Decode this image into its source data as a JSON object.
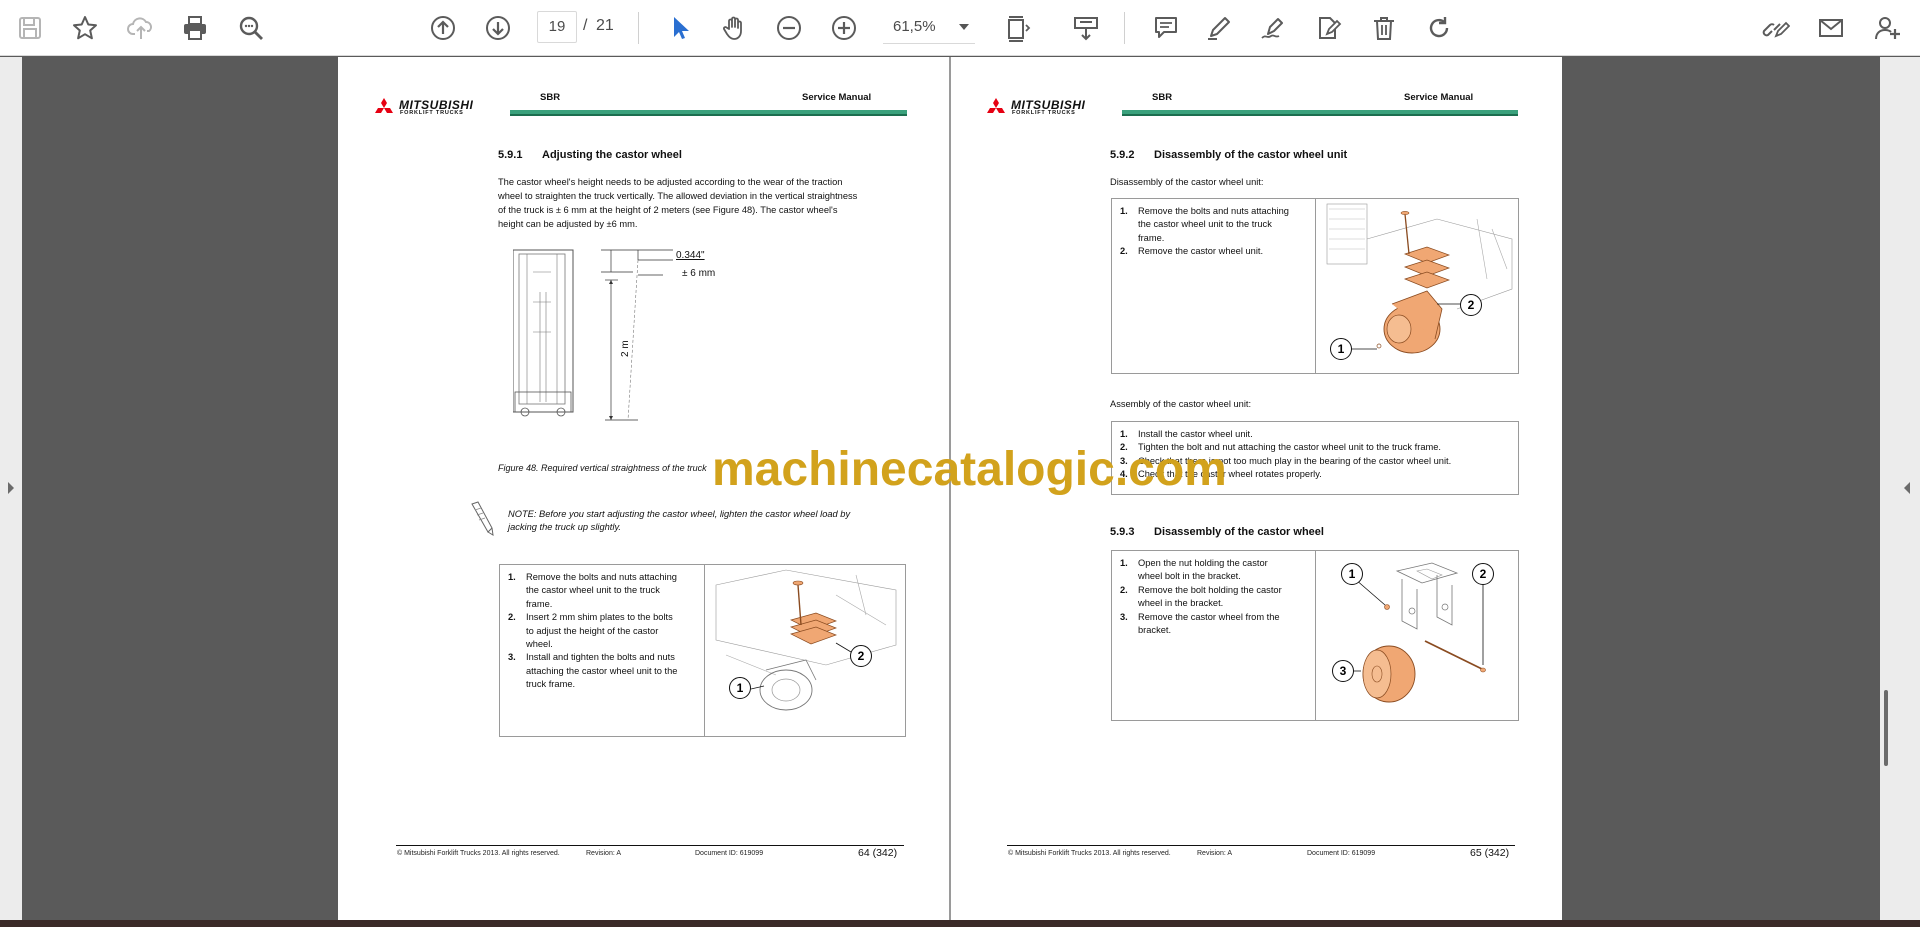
{
  "toolbar": {
    "page_current": "19",
    "page_separator": "/",
    "page_total": "21",
    "zoom_value": "61,5%"
  },
  "doc_header": {
    "brand_line1": "MITSUBISHI",
    "brand_line2": "FORKLIFT TRUCKS",
    "model": "SBR",
    "title": "Service Manual"
  },
  "left_page": {
    "section_num": "5.9.1",
    "section_title": "Adjusting the castor wheel",
    "para_lines": [
      "The castor wheel's height needs to be adjusted according to the wear of the traction",
      "wheel to straighten the truck vertically. The allowed deviation in the vertical straightness",
      "of the truck is ± 6 mm at the height of 2 meters (see Figure 48). The castor wheel's",
      "height can be adjusted by ±6 mm."
    ],
    "fig_dim1": "0.344\"",
    "fig_dim2": "± 6 mm",
    "fig_dim3": "2 m",
    "figure_caption": "Figure 48. Required vertical straightness of the truck",
    "note_line1": "NOTE: Before you start adjusting the castor wheel, lighten the castor wheel load by",
    "note_line2": "jacking the truck up slightly.",
    "steps": [
      {
        "n": "1.",
        "lines": [
          "Remove the bolts and nuts attaching",
          "the castor wheel unit to the truck",
          "frame."
        ]
      },
      {
        "n": "2.",
        "lines": [
          "Insert 2 mm shim plates to the bolts",
          "to adjust the height of the castor",
          "wheel."
        ]
      },
      {
        "n": "3.",
        "lines": [
          "Install and tighten the bolts and nuts",
          "attaching the castor wheel unit to the",
          "truck frame."
        ]
      }
    ],
    "callout1": "1",
    "callout2": "2",
    "footer_copy": "© Mitsubishi Forklift Trucks 2013. All rights reserved.",
    "footer_rev": "Revision: A",
    "footer_doc": "Document ID: 619099",
    "footer_page": "64 (342)"
  },
  "right_page": {
    "s1_num": "5.9.2",
    "s1_title": "Disassembly of the castor wheel unit",
    "s1_intro": "Disassembly of the castor wheel unit:",
    "s1_steps": [
      {
        "n": "1.",
        "lines": [
          "Remove the bolts and nuts attaching",
          "the castor wheel unit to the truck",
          "frame."
        ]
      },
      {
        "n": "2.",
        "lines": [
          "Remove the castor wheel unit."
        ]
      }
    ],
    "s1_callout1": "1",
    "s1_callout2": "2",
    "s2_intro": "Assembly of the castor wheel unit:",
    "s2_steps": [
      {
        "n": "1.",
        "lines": [
          "Install the castor wheel unit."
        ]
      },
      {
        "n": "2.",
        "lines": [
          "Tighten the bolt and nut attaching the castor wheel unit to the truck frame."
        ]
      },
      {
        "n": "3.",
        "lines": [
          "Check that there is not too much play in the bearing of the castor wheel unit."
        ]
      },
      {
        "n": "4.",
        "lines": [
          "Check that the castor wheel rotates properly."
        ]
      }
    ],
    "s3_num": "5.9.3",
    "s3_title": "Disassembly of the castor wheel",
    "s3_steps": [
      {
        "n": "1.",
        "lines": [
          "Open the nut holding the castor",
          "wheel bolt in the bracket."
        ]
      },
      {
        "n": "2.",
        "lines": [
          "Remove the bolt holding the castor",
          "wheel in the bracket."
        ]
      },
      {
        "n": "3.",
        "lines": [
          "Remove the castor wheel from the",
          "bracket."
        ]
      }
    ],
    "s3_callout1": "1",
    "s3_callout2": "2",
    "s3_callout3": "3",
    "footer_copy": "© Mitsubishi Forklift Trucks 2013. All rights reserved.",
    "footer_rev": "Revision: A",
    "footer_doc": "Document ID: 619099",
    "footer_page": "65 (342)"
  },
  "watermark": "machinecatalogic.com",
  "colors": {
    "accent_blue": "#2a6fd1",
    "icon_gray": "#5b5b5b",
    "header_green": "#3aa17c",
    "part_orange": "#f0a773",
    "watermark": "#d2a21c",
    "brand_red": "#e60012"
  }
}
